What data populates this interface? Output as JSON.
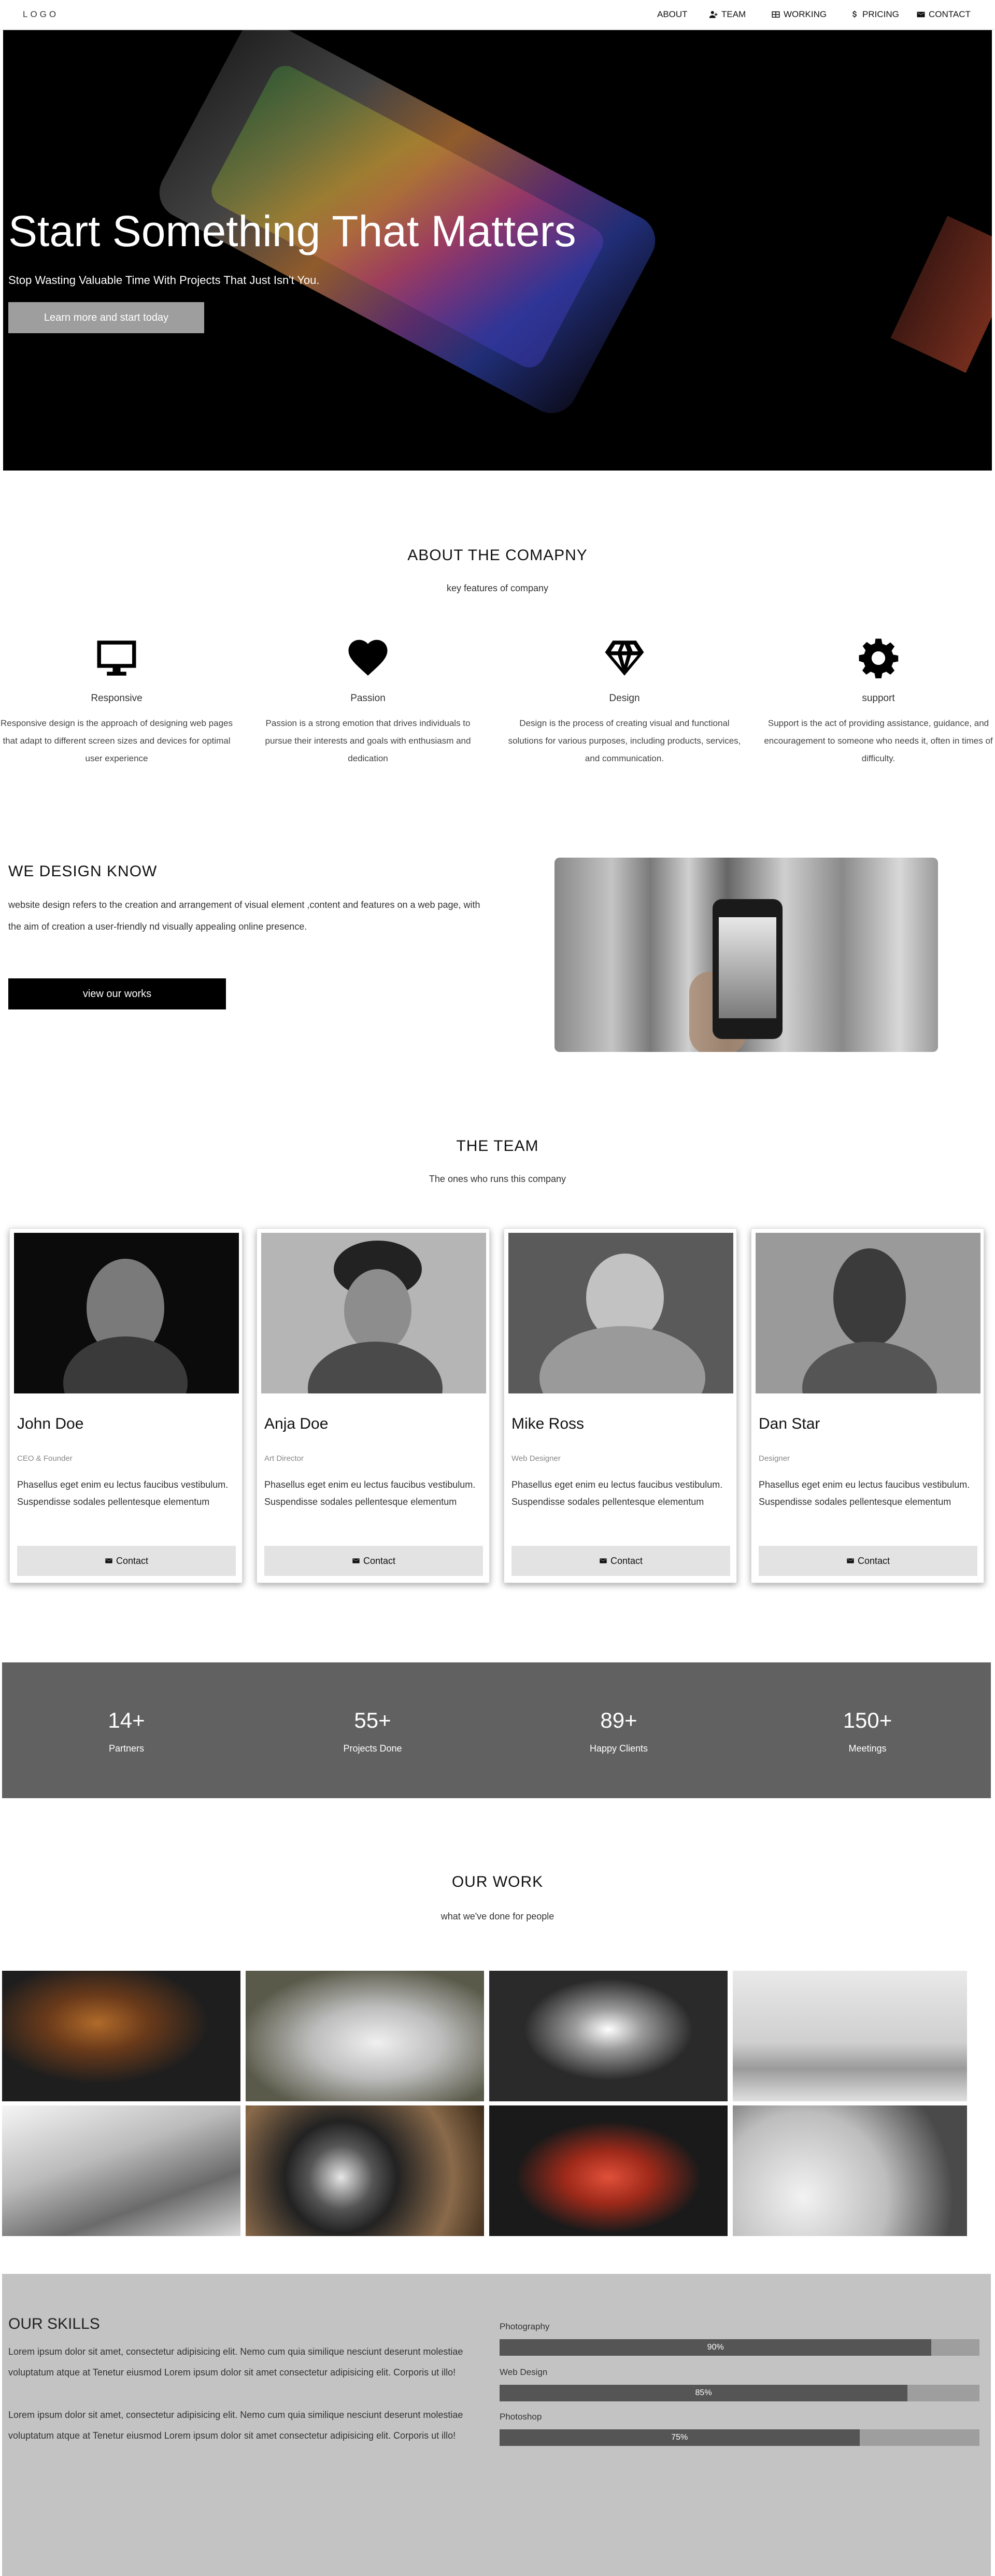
{
  "navbar": {
    "logo": "LOGO",
    "links": [
      {
        "label": "ABOUT",
        "icon": "none"
      },
      {
        "label": "TEAM",
        "icon": "user-plus-icon"
      },
      {
        "label": "WORKING",
        "icon": "grid-icon"
      },
      {
        "label": "PRICING",
        "icon": "dollar-icon"
      },
      {
        "label": "CONTACT",
        "icon": "envelope-icon"
      }
    ]
  },
  "hero": {
    "title": "Start Something That Matters",
    "subtitle": "Stop Wasting Valuable Time With Projects That Just Isn't You.",
    "button_label": "Learn more and start today",
    "social_icons": [
      "facebook-icon",
      "instagram-icon",
      "twitter-icon",
      "linkedin-icon",
      "email-icon"
    ]
  },
  "about": {
    "title": "ABOUT THE COMAPNY",
    "subtitle": "key features of company",
    "features": [
      {
        "icon": "desktop-icon",
        "title": "Responsive",
        "desc": "Responsive design is the approach of designing web pages that adapt to different screen sizes and devices for optimal user experience"
      },
      {
        "icon": "heart-icon",
        "title": "Passion",
        "desc": "Passion is a strong emotion that drives individuals to pursue their interests and goals with enthusiasm and dedication"
      },
      {
        "icon": "diamond-icon",
        "title": "Design",
        "desc": "Design is the process of creating visual and functional solutions for various purposes, including products, services, and communication."
      },
      {
        "icon": "gear-icon",
        "title": "support",
        "desc": "Support is the act of providing assistance, guidance, and encouragement to someone who needs it, often in times of difficulty."
      }
    ]
  },
  "we_design": {
    "title": "WE DESIGN KNOW",
    "text": "website design refers to the creation and arrangement of visual element ,content and features on a web page, with the aim of creation a user-friendly nd visually appealing online presence.",
    "button_label": "view our works"
  },
  "team": {
    "title": "THE TEAM",
    "subtitle": "The ones who runs this company",
    "members": [
      {
        "name": "John Doe",
        "role": "CEO & Founder",
        "desc": "Phasellus eget enim eu lectus faucibus vestibulum. Suspendisse sodales pellentesque elementum",
        "button": "Contact"
      },
      {
        "name": "Anja Doe",
        "role": "Art Director",
        "desc": "Phasellus eget enim eu lectus faucibus vestibulum. Suspendisse sodales pellentesque elementum",
        "button": "Contact"
      },
      {
        "name": "Mike Ross",
        "role": "Web Designer",
        "desc": "Phasellus eget enim eu lectus faucibus vestibulum. Suspendisse sodales pellentesque elementum",
        "button": "Contact"
      },
      {
        "name": "Dan Star",
        "role": "Designer",
        "desc": "Phasellus eget enim eu lectus faucibus vestibulum. Suspendisse sodales pellentesque elementum",
        "button": "Contact"
      }
    ]
  },
  "stats": [
    {
      "value": "14+",
      "label": "Partners"
    },
    {
      "value": "55+",
      "label": "Projects Done"
    },
    {
      "value": "89+",
      "label": "Happy Clients"
    },
    {
      "value": "150+",
      "label": "Meetings"
    }
  ],
  "work": {
    "title": "OUR WORK",
    "subtitle": "what we've done for people",
    "items": [
      "microphone",
      "iphone",
      "drone",
      "sound-mixer",
      "tablet",
      "camera",
      "typewriter",
      "turntable"
    ]
  },
  "skills": {
    "title": "OUR SKILLS",
    "paragraphs": [
      "Lorem ipsum dolor sit amet, consectetur adipisicing elit. Nemo cum quia similique nesciunt deserunt molestiae voluptatum atque at Tenetur eiusmod Lorem ipsum dolor sit amet consectetur adipisicing elit. Corporis ut illo!",
      "Lorem ipsum dolor sit amet, consectetur adipisicing elit. Nemo cum quia similique nesciunt deserunt molestiae voluptatum atque at Tenetur eiusmod Lorem ipsum dolor sit amet consectetur adipisicing elit. Corporis ut illo!"
    ],
    "bars": [
      {
        "label": "Photography",
        "percent": 90,
        "text": "90%"
      },
      {
        "label": "Web Design",
        "percent": 85,
        "text": "85%"
      },
      {
        "label": "Photoshop",
        "percent": 75,
        "text": "75%"
      }
    ]
  }
}
